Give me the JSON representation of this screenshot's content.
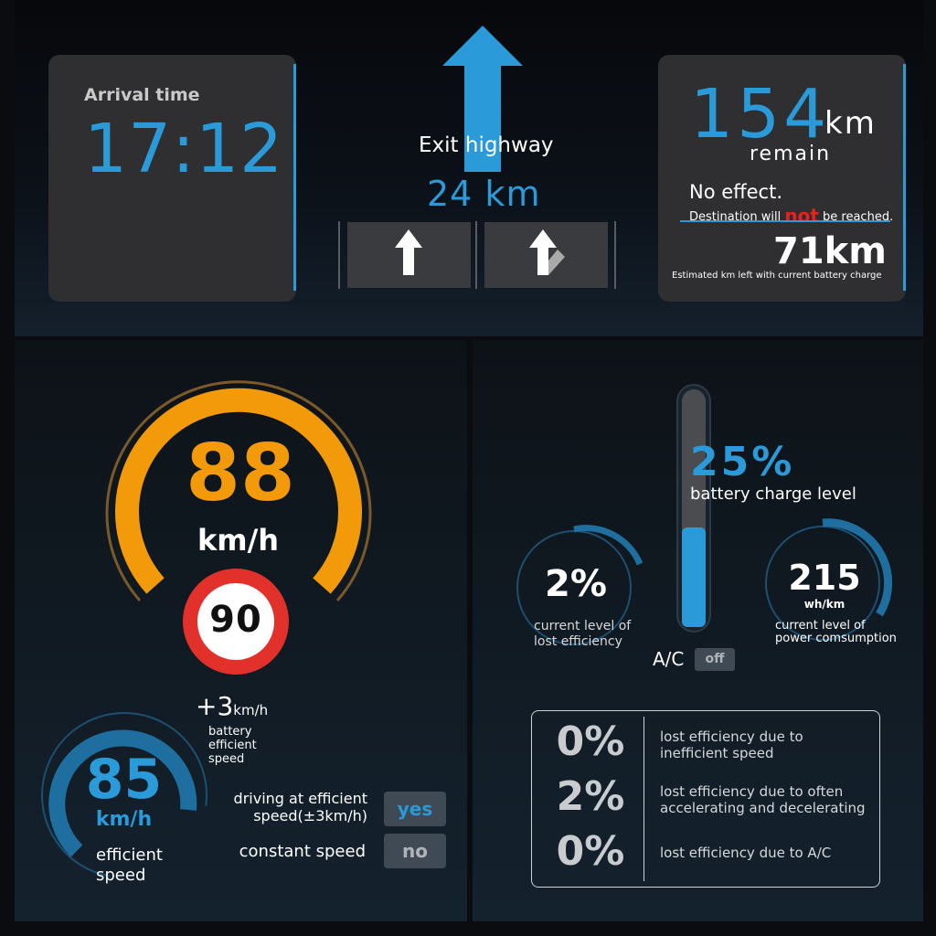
{
  "arrival": {
    "label": "Arrival time",
    "time": "17:12"
  },
  "navigation": {
    "instruction": "Exit highway",
    "distance": "24 km",
    "lanes": [
      {
        "direction": "straight"
      },
      {
        "direction": "straight-exit-right"
      }
    ],
    "arrow_color": "#2a9ad8"
  },
  "range": {
    "remaining_value": "154",
    "remaining_unit": "km",
    "remaining_label": "remain",
    "effect_title": "No effect.",
    "destination_prefix": "Destination will ",
    "destination_not": "not",
    "destination_suffix": " be reached.",
    "estimated_value": "71km",
    "estimated_label": "Estimated km left with current battery charge"
  },
  "speed": {
    "current": "88",
    "unit": "km/h",
    "limit": "90",
    "gauge_fraction": 0.88,
    "color": "#f29a0a"
  },
  "battery_efficient": {
    "delta_prefix": "+3",
    "delta_unit": "km/h",
    "label": "battery efficient speed"
  },
  "efficient_speed": {
    "value": "85",
    "unit": "km/h",
    "label": "efficient speed"
  },
  "driving_status": {
    "efficient_label": "driving at efficient speed(±3km/h)",
    "efficient_value": "yes",
    "constant_label": "constant speed",
    "constant_value": "no"
  },
  "battery": {
    "percent": "25%",
    "level_fraction": 0.42,
    "label": "battery charge level",
    "ac_label": "A/C",
    "ac_value": "off"
  },
  "lost_efficiency": {
    "value": "2%",
    "label_line1": "current level of",
    "label_line2": "lost efficiency"
  },
  "power": {
    "value": "215",
    "unit": "wh/km",
    "label_line1": "current level of",
    "label_line2": "power comsumption"
  },
  "loss_breakdown": [
    {
      "percent": "0%",
      "desc_line1": "lost efficiency due to",
      "desc_line2": "inefficient speed"
    },
    {
      "percent": "2%",
      "desc_line1": "lost efficiency due to often",
      "desc_line2": "accelerating and decelerating"
    },
    {
      "percent": "0%",
      "desc_line1": "lost efficiency due to A/C",
      "desc_line2": ""
    }
  ],
  "colors": {
    "accent": "#2a9ad8",
    "speed": "#f29a0a",
    "limit": "#e2312b",
    "card": "#2f2f31"
  }
}
